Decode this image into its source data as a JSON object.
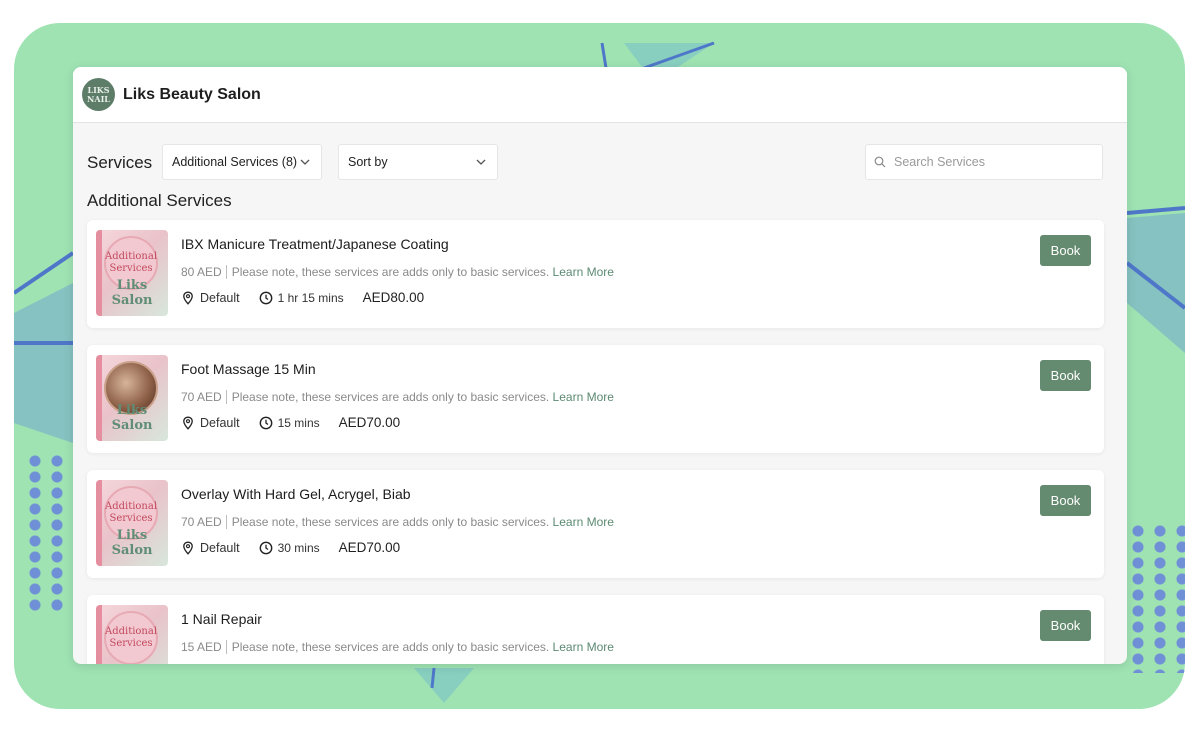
{
  "header": {
    "logo_lines": [
      "LIKS",
      "NAIL"
    ],
    "salon_name": "Liks Beauty Salon"
  },
  "toolbar": {
    "services_label": "Services",
    "category_select": "Additional Services (8)",
    "sort_select": "Sort by",
    "search_placeholder": "Search Services"
  },
  "section_title": "Additional Services",
  "services": [
    {
      "name": "IBX Manicure Treatment/Japanese Coating",
      "price_text": "80 AED",
      "note": "Please note, these services are adds only to basic services.",
      "learn_more": "Learn More",
      "location": "Default",
      "duration": "1 hr 15 mins",
      "price": "AED80.00",
      "book_label": "Book",
      "thumb_lines": [
        "Additional",
        "Services"
      ],
      "thumb_brand": "Liks Salon"
    },
    {
      "name": "Foot Massage 15 Min",
      "price_text": "70 AED",
      "note": "Please note, these services are adds only to basic services.",
      "learn_more": "Learn More",
      "location": "Default",
      "duration": "15 mins",
      "price": "AED70.00",
      "book_label": "Book",
      "thumb_brand": "Liks Salon"
    },
    {
      "name": "Overlay With Hard Gel, Acrygel, Biab",
      "price_text": "70 AED",
      "note": "Please note, these services are adds only to basic services.",
      "learn_more": "Learn More",
      "location": "Default",
      "duration": "30 mins",
      "price": "AED70.00",
      "book_label": "Book",
      "thumb_lines": [
        "Additional",
        "Services"
      ],
      "thumb_brand": "Liks Salon"
    },
    {
      "name": "1 Nail Repair",
      "price_text": "15 AED",
      "note": "Please note, these services are adds only to basic services.",
      "learn_more": "Learn More",
      "book_label": "Book",
      "thumb_lines": [
        "Additional",
        "Services"
      ]
    }
  ],
  "colors": {
    "accent": "#648a6f",
    "background": "#9fe3b3",
    "link": "#5c8a72"
  }
}
